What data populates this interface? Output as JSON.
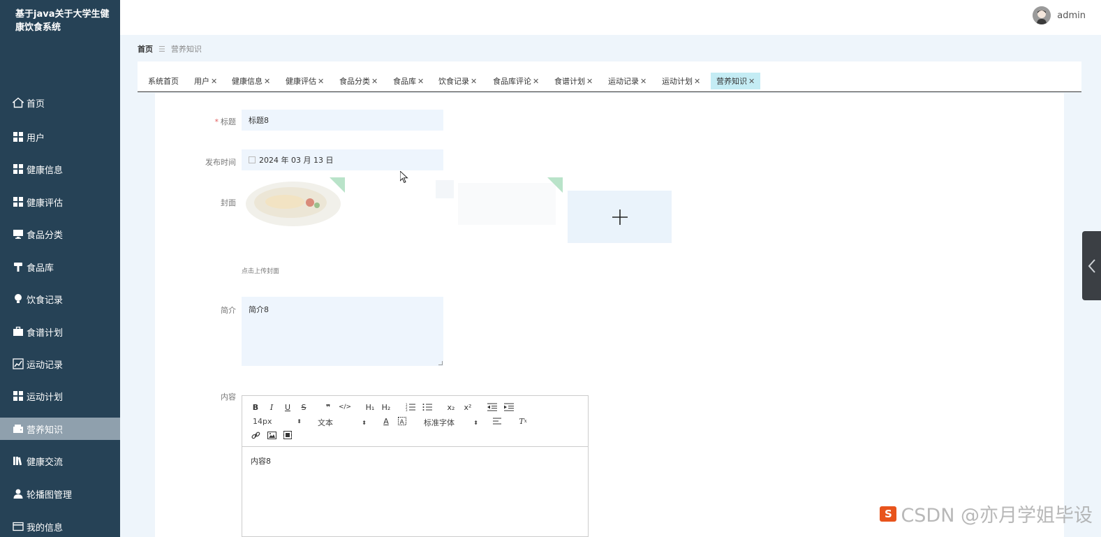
{
  "app": {
    "title": "基于java关于大学生健康饮食系统",
    "user": "admin"
  },
  "sidebar": {
    "items": [
      {
        "label": "首页",
        "icon": "home-icon"
      },
      {
        "label": "用户",
        "icon": "grid-icon"
      },
      {
        "label": "健康信息",
        "icon": "grid-icon"
      },
      {
        "label": "健康评估",
        "icon": "grid-icon"
      },
      {
        "label": "食品分类",
        "icon": "monitor-icon"
      },
      {
        "label": "食品库",
        "icon": "hammer-icon"
      },
      {
        "label": "饮食记录",
        "icon": "bulb-icon"
      },
      {
        "label": "食谱计划",
        "icon": "briefcase-icon"
      },
      {
        "label": "运动记录",
        "icon": "chart-icon"
      },
      {
        "label": "运动计划",
        "icon": "grid-icon"
      },
      {
        "label": "营养知识",
        "icon": "wallet-icon",
        "active": true
      },
      {
        "label": "健康交流",
        "icon": "books-icon"
      },
      {
        "label": "轮播图管理",
        "icon": "user-icon"
      },
      {
        "label": "我的信息",
        "icon": "card-icon"
      }
    ]
  },
  "breadcrumb": {
    "home": "首页",
    "separator": "☰",
    "current": "营养知识"
  },
  "tabs": [
    {
      "label": "系统首页",
      "closable": false
    },
    {
      "label": "用户",
      "closable": true
    },
    {
      "label": "健康信息",
      "closable": true
    },
    {
      "label": "健康评估",
      "closable": true
    },
    {
      "label": "食品分类",
      "closable": true
    },
    {
      "label": "食品库",
      "closable": true
    },
    {
      "label": "饮食记录",
      "closable": true
    },
    {
      "label": "食品库评论",
      "closable": true
    },
    {
      "label": "食谱计划",
      "closable": true
    },
    {
      "label": "运动记录",
      "closable": true
    },
    {
      "label": "运动计划",
      "closable": true
    },
    {
      "label": "营养知识",
      "closable": true,
      "active": true
    }
  ],
  "tab_close_glyph": "✕",
  "form": {
    "title_label": "标题",
    "title_required_mark": "*",
    "title_value": "标题8",
    "date_label": "发布时间",
    "date_value": "2024 年 03 月 13 日",
    "cover_label": "封面",
    "cover_upload_tip": "点击上传封面",
    "intro_label": "简介",
    "intro_value": "简介8",
    "content_label": "内容",
    "content_value": "内容8"
  },
  "editor": {
    "font_size": "14px",
    "block_type": "文本",
    "font_family": "标准字体",
    "buttons_row1": [
      "B",
      "I",
      "U",
      "S",
      "❞",
      "</>",
      "H1",
      "H2",
      "ol",
      "ul",
      "x₂",
      "x²",
      "outdent",
      "indent"
    ]
  },
  "watermark": {
    "logo": "S",
    "text": "CSDN @亦月学姐毕设"
  },
  "colors": {
    "sidebar_bg": "#264256",
    "active_menu": "#8fa0ad",
    "active_tab": "#c4ecf4",
    "input_bg": "#eef5fd",
    "required": "#e05c5c"
  }
}
